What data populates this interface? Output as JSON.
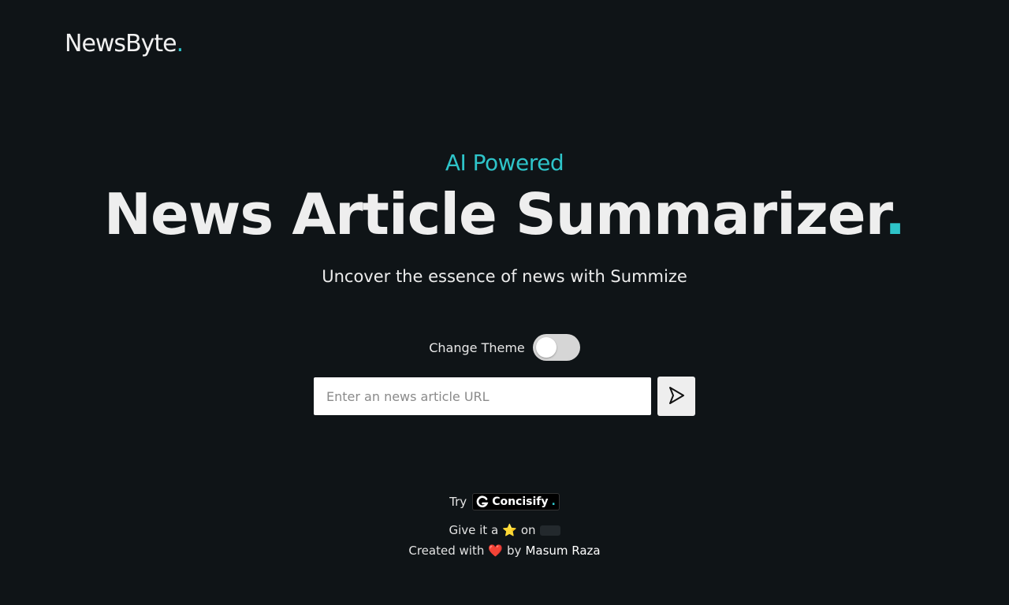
{
  "brand": {
    "name": "NewsByte",
    "dot": "."
  },
  "hero": {
    "eyebrow": "AI Powered",
    "title": "News Article Summarizer",
    "title_dot": ".",
    "subtitle": "Uncover the essence of news with Summize"
  },
  "theme": {
    "label": "Change Theme",
    "enabled": false
  },
  "search": {
    "placeholder": "Enter an news article URL",
    "value": ""
  },
  "footer": {
    "try_label": "Try",
    "concisify_name": "Concisify",
    "concisify_dot": ".",
    "star_prefix": "Give it a",
    "star_emoji": "⭐",
    "star_suffix": "on",
    "credit_prefix": "Created with",
    "heart": "❤️",
    "credit_by": "by",
    "author": "Masum Raza"
  },
  "colors": {
    "accent": "#2ec4c9",
    "background": "#0f1417"
  }
}
